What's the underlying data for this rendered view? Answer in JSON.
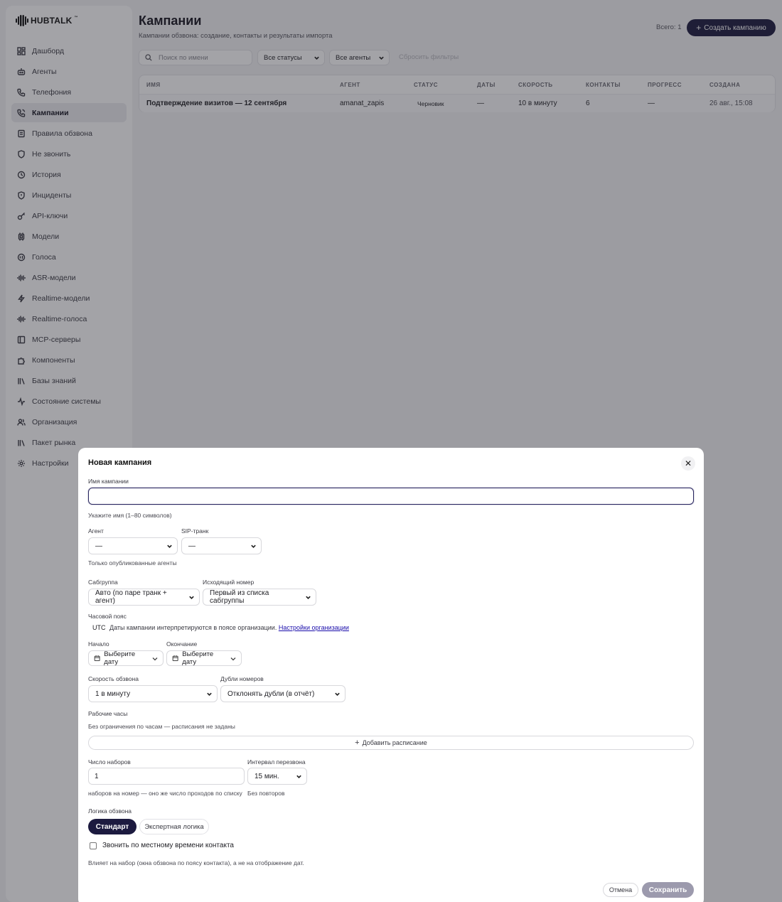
{
  "brand": {
    "name": "HUBTALK",
    "tm": "™"
  },
  "sidebar": {
    "items": [
      {
        "label": "Дашборд",
        "icon": "dashboard-icon",
        "active": false
      },
      {
        "label": "Агенты",
        "icon": "robot-icon",
        "active": false
      },
      {
        "label": "Телефония",
        "icon": "phone-icon",
        "active": false
      },
      {
        "label": "Кампании",
        "icon": "phone-outgoing-icon",
        "active": true
      },
      {
        "label": "Правила обзвона",
        "icon": "rules-icon",
        "active": false
      },
      {
        "label": "Не звонить",
        "icon": "shield-icon",
        "active": false
      },
      {
        "label": "История",
        "icon": "history-icon",
        "active": false
      },
      {
        "label": "Инциденты",
        "icon": "alert-shield-icon",
        "active": false
      },
      {
        "label": "API-ключи",
        "icon": "key-icon",
        "active": false
      },
      {
        "label": "Модели",
        "icon": "cpu-icon",
        "active": false
      },
      {
        "label": "Голоса",
        "icon": "audio-icon",
        "active": false
      },
      {
        "label": "ASR-модели",
        "icon": "waveform-icon",
        "active": false
      },
      {
        "label": "Realtime-модели",
        "icon": "lightning-icon",
        "active": false
      },
      {
        "label": "Realtime-голоса",
        "icon": "waveform-icon",
        "active": false
      },
      {
        "label": "MCP-серверы",
        "icon": "server-icon",
        "active": false
      },
      {
        "label": "Компоненты",
        "icon": "puzzle-icon",
        "active": false
      },
      {
        "label": "Базы знаний",
        "icon": "library-icon",
        "active": false
      },
      {
        "label": "Состояние системы",
        "icon": "activity-icon",
        "active": false
      },
      {
        "label": "Организация",
        "icon": "users-icon",
        "active": false
      },
      {
        "label": "Пакет рынка",
        "icon": "library-icon",
        "active": false
      },
      {
        "label": "Настройки",
        "icon": "gear-icon",
        "active": false
      }
    ]
  },
  "header": {
    "title": "Кампании",
    "subtitle": "Кампании обзвона: создание, контакты и результаты импорта",
    "total": "Всего: 1",
    "create_label": "Создать кампанию"
  },
  "filters": {
    "search_placeholder": "Поиск по имени",
    "status": "Все статусы",
    "agents": "Все агенты",
    "reset": "Сбросить фильтры"
  },
  "table": {
    "columns": [
      "Имя",
      "Агент",
      "Статус",
      "Даты",
      "Скорость",
      "Контакты",
      "Прогресс",
      "Создана"
    ],
    "rows": [
      {
        "name": "Подтверждение визитов — 12 сентября",
        "agent": "amanat_zapis",
        "status": "Черновик",
        "dates": "—",
        "speed": "10 в минуту",
        "contacts": "6",
        "progress": "—",
        "created": "26 авг., 15:08"
      }
    ]
  },
  "modal": {
    "title": "Новая кампания",
    "name_label": "Имя кампании",
    "name_value": "",
    "name_hint": "Укажите имя (1–80 символов)",
    "agent_label": "Агент",
    "agent_value": "—",
    "sip_label": "SIP-транк",
    "sip_value": "—",
    "agent_hint": "Только опубликованные агенты",
    "subgroup_label": "Сабгруппа",
    "subgroup_value": "Авто (по паре транк + агент)",
    "outgoing_label": "Исходящий номер",
    "outgoing_value": "Первый из списка сабгруппы",
    "tz_label": "Часовой пояс",
    "tz_value": "UTC",
    "tz_note": "Даты кампании интерпретируются в поясе организации.",
    "tz_link": "Настройки организации",
    "start_label": "Начало",
    "start_value": "Выберите дату",
    "end_label": "Окончание",
    "end_value": "Выберите дату",
    "speed_label": "Скорость обзвона",
    "speed_value": "1 в минуту",
    "dupes_label": "Дубли номеров",
    "dupes_value": "Отклонять дубли (в отчёт)",
    "hours_label": "Рабочие часы",
    "hours_note": "Без ограничения по часам — расписания не заданы",
    "add_schedule": "Добавить расписание",
    "dials_label": "Число наборов",
    "dials_value": "1",
    "dials_hint": "наборов на номер — оно же число проходов по списку",
    "retry_label": "Интервал перезвона",
    "retry_value": "15 мин.",
    "retry_hint": "Без повторов",
    "logic_label": "Логика обзвона",
    "logic_standard": "Стандарт",
    "logic_expert": "Экспертная логика",
    "local_time_label": "Звонить по местному времени контакта",
    "local_time_hint": "Влияет на набор (окна обзвона по поясу контакта), а не на отображение дат.",
    "cancel": "Отмена",
    "save": "Сохранить"
  },
  "colors": {
    "accent": "#1c1a3f",
    "save_disabled": "#9c9aad",
    "link": "#1a0dab"
  }
}
